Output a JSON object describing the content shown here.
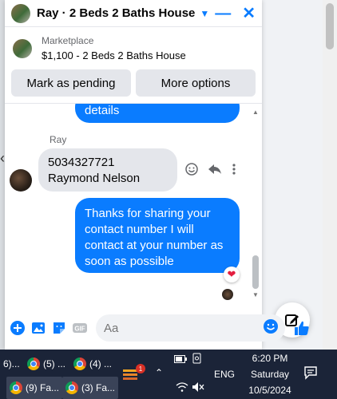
{
  "chat": {
    "title": "Ray · 2 Beds 2 Baths House",
    "marketplace_label": "Marketplace",
    "listing": "$1,100 - 2 Beds 2 Baths House",
    "actions": [
      "Mark as pending",
      "More options"
    ]
  },
  "messages": {
    "top_fragment": "details",
    "sender": "Ray",
    "incoming": "5034327721 Raymond Nelson",
    "outgoing": "Thanks for sharing your contact number I will contact at your number as soon as possible",
    "reaction": "❤"
  },
  "composer": {
    "placeholder": "Aa"
  },
  "taskbar": {
    "apps": [
      {
        "label": "6)..."
      },
      {
        "label": "(5) ..."
      },
      {
        "label": "(4) ..."
      },
      {
        "label": "(9) Fa..."
      },
      {
        "label": "(3) Fa..."
      }
    ],
    "notification_count": "1",
    "language": "ENG",
    "time": "6:20 PM",
    "day": "Saturday",
    "date": "10/5/2024"
  }
}
